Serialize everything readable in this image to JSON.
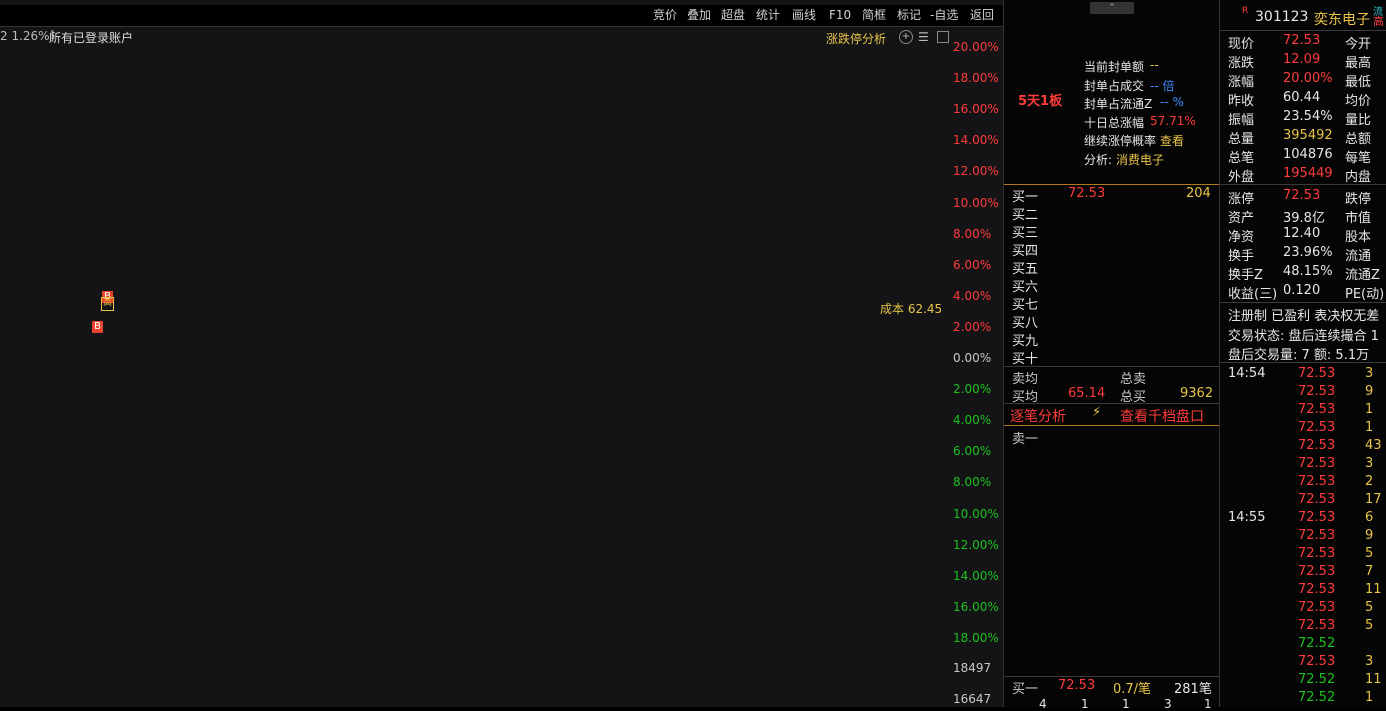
{
  "toolbar": {
    "buttons": [
      "竞价",
      "叠加",
      "超盘",
      "统计",
      "画线",
      "F10",
      "简框",
      "标记",
      "-自选",
      "返回"
    ]
  },
  "chart_header": {
    "pct_text": "2 1.26%]",
    "account_text": "所有已登录账户",
    "analysis_link": "涨跌停分析",
    "icons": [
      "plus-circle-icon",
      "menu-icon",
      "square-icon"
    ]
  },
  "cost_label": "成本 62.45",
  "markers": [
    "B",
    "B",
    "高"
  ],
  "chart_data": {
    "type": "line",
    "pct_axis_labels": [
      "20.00%",
      "18.00%",
      "16.00%",
      "14.00%",
      "12.00%",
      "10.00%",
      "8.00%",
      "6.00%",
      "4.00%",
      "2.00%",
      "0.00%",
      "2.00%",
      "4.00%",
      "6.00%",
      "8.00%",
      "10.00%",
      "12.00%",
      "14.00%",
      "16.00%",
      "18.00%"
    ],
    "volume_axis_labels": [
      "18497",
      "16647"
    ],
    "ylim": [
      -20,
      20
    ],
    "cost_line": 62.45,
    "colors": {
      "price": "#ffffff",
      "avg": "#e8c547",
      "up": "#ff3b3b",
      "down": "#1cc21c",
      "cyan": "#36c5d6",
      "gray": "#a0a0a0"
    }
  },
  "mid_panel": {
    "top_arrow": "up-arrow-icon",
    "board_tag": "5天1板",
    "info": [
      {
        "label": "当前封单额",
        "value": "--",
        "color": "yellow"
      },
      {
        "label": "封单占成交",
        "value": "-- 倍",
        "color": "blue"
      },
      {
        "label": "封单占流通Z",
        "value": "--  %",
        "color": "blue"
      },
      {
        "label": "十日总涨幅",
        "value": "57.71%",
        "color": "red"
      },
      {
        "label": "继续涨停概率",
        "value": "查看",
        "color": "yellow"
      },
      {
        "label": "分析:",
        "value": "消费电子",
        "color": "yellow"
      }
    ],
    "buy_levels": [
      {
        "label": "买一",
        "price": "72.53",
        "vol": "204"
      },
      {
        "label": "买二",
        "price": "",
        "vol": ""
      },
      {
        "label": "买三",
        "price": "",
        "vol": ""
      },
      {
        "label": "买四",
        "price": "",
        "vol": ""
      },
      {
        "label": "买五",
        "price": "",
        "vol": ""
      },
      {
        "label": "买六",
        "price": "",
        "vol": ""
      },
      {
        "label": "买七",
        "price": "",
        "vol": ""
      },
      {
        "label": "买八",
        "price": "",
        "vol": ""
      },
      {
        "label": "买九",
        "price": "",
        "vol": ""
      },
      {
        "label": "买十",
        "price": "",
        "vol": ""
      }
    ],
    "sell_avg_label": "卖均",
    "total_sell_label": "总卖",
    "buy_avg_label": "买均",
    "buy_avg_value": "65.14",
    "total_buy_label": "总买",
    "total_buy_value": "9362",
    "tick_analysis": "逐笔分析",
    "lightning_icon": "lightning-icon",
    "thousand_levels": "查看千档盘口",
    "sell_one": "卖一",
    "bottom_label": "买一",
    "bottom_price": "72.53",
    "bottom_avg": "0.7/笔",
    "bottom_count": "281笔",
    "bottom_row": [
      "4",
      "1",
      "1",
      "3",
      "1"
    ]
  },
  "right_panel": {
    "badge": "R",
    "code": "301123",
    "name": "奕东电子",
    "tag": "高",
    "tag_top": "流",
    "stats": [
      {
        "l": "现价",
        "v": "72.53",
        "vc": "red",
        "l2": "今开"
      },
      {
        "l": "涨跌",
        "v": "12.09",
        "vc": "red",
        "l2": "最高"
      },
      {
        "l": "涨幅",
        "v": "20.00%",
        "vc": "red",
        "l2": "最低"
      },
      {
        "l": "昨收",
        "v": "60.44",
        "vc": "white",
        "l2": "均价"
      },
      {
        "l": "振幅",
        "v": "23.54%",
        "vc": "white",
        "l2": "量比"
      },
      {
        "l": "总量",
        "v": "395492",
        "vc": "yellow",
        "l2": "总额"
      },
      {
        "l": "总笔",
        "v": "104876",
        "vc": "white",
        "l2": "每笔"
      },
      {
        "l": "外盘",
        "v": "195449",
        "vc": "red",
        "l2": "内盘"
      }
    ],
    "stats2": [
      {
        "l": "涨停",
        "v": "72.53",
        "vc": "red",
        "l2": "跌停"
      },
      {
        "l": "资产",
        "v": "39.8亿",
        "vc": "white",
        "l2": "市值"
      },
      {
        "l": "净资",
        "v": "12.40",
        "vc": "white",
        "l2": "股本"
      },
      {
        "l": "换手",
        "v": "23.96%",
        "vc": "white",
        "l2": "流通"
      },
      {
        "l": "换手Z",
        "v": "48.15%",
        "vc": "white",
        "l2": "流通Z"
      },
      {
        "l": "收益(三)",
        "v": "0.120",
        "vc": "white",
        "l2": "PE(动)"
      }
    ],
    "reg_text": "注册制 已盈利 表决权无差",
    "trade_status": "交易状态: 盘后连续撮合 1",
    "after_trade": "盘后交易量: 7  额: 5.1万",
    "ticks": [
      {
        "t": "14:54",
        "p": "72.53",
        "v": "3"
      },
      {
        "t": "",
        "p": "72.53",
        "v": "9"
      },
      {
        "t": "",
        "p": "72.53",
        "v": "1"
      },
      {
        "t": "",
        "p": "72.53",
        "v": "1"
      },
      {
        "t": "",
        "p": "72.53",
        "v": "43"
      },
      {
        "t": "",
        "p": "72.53",
        "v": "3"
      },
      {
        "t": "",
        "p": "72.53",
        "v": "2"
      },
      {
        "t": "",
        "p": "72.53",
        "v": "17"
      },
      {
        "t": "14:55",
        "p": "72.53",
        "v": "6"
      },
      {
        "t": "",
        "p": "72.53",
        "v": "9"
      },
      {
        "t": "",
        "p": "72.53",
        "v": "5"
      },
      {
        "t": "",
        "p": "72.53",
        "v": "7"
      },
      {
        "t": "",
        "p": "72.53",
        "v": "11"
      },
      {
        "t": "",
        "p": "72.53",
        "v": "5"
      },
      {
        "t": "",
        "p": "72.53",
        "v": "5"
      },
      {
        "t": "",
        "p": "72.52",
        "v": ""
      },
      {
        "t": "",
        "p": "72.53",
        "v": "3"
      },
      {
        "t": "",
        "p": "72.52",
        "v": "11"
      },
      {
        "t": "",
        "p": "72.52",
        "v": "1"
      }
    ]
  }
}
